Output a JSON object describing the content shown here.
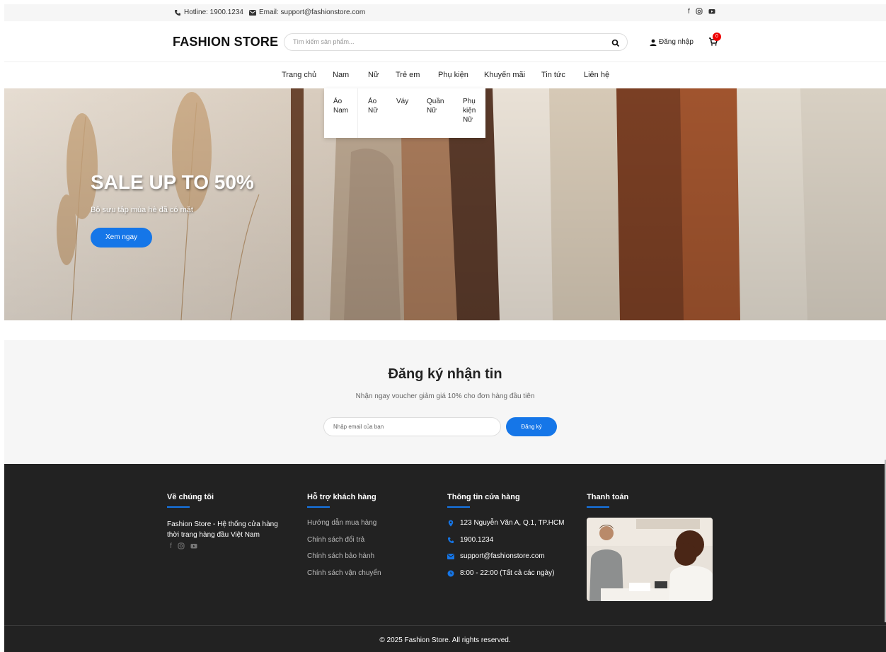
{
  "topbar": {
    "hotline": "Hotline: 1900.1234",
    "email": "Email: support@fashionstore.com",
    "social_icons": [
      "facebook-icon",
      "instagram-icon",
      "youtube-icon"
    ]
  },
  "header": {
    "logo": "FASHION STORE",
    "search_placeholder": "Tìm kiếm sản phẩm...",
    "login_label": "Đăng nhập",
    "cart_count": "0"
  },
  "nav": {
    "items": [
      {
        "label": "Trang chủ"
      },
      {
        "label": "Nam"
      },
      {
        "label": "Nữ"
      },
      {
        "label": "Trẻ em"
      },
      {
        "label": "Phụ kiện"
      },
      {
        "label": "Khuyến mãi"
      },
      {
        "label": "Tin tức"
      },
      {
        "label": "Liên hệ"
      }
    ]
  },
  "dropdown": {
    "items": [
      {
        "line1": "Áo",
        "line2": "Nam",
        "line3": ""
      },
      {
        "line1": "Áo",
        "line2": "Nữ",
        "line3": ""
      },
      {
        "line1": "Váy",
        "line2": "",
        "line3": ""
      },
      {
        "line1": "Quần",
        "line2": "Nữ",
        "line3": ""
      },
      {
        "line1": "Phụ",
        "line2": "kiện",
        "line3": "Nữ"
      }
    ]
  },
  "hero": {
    "title": "SALE UP TO 50%",
    "subtitle": "Bộ sưu tập mùa hè đã có mặt",
    "button": "Xem ngay"
  },
  "newsletter": {
    "title": "Đăng ký nhận tin",
    "subtitle": "Nhận ngay voucher giảm giá 10% cho đơn hàng đầu tiên",
    "placeholder": "Nhập email của bạn",
    "button": "Đăng ký"
  },
  "footer": {
    "about": {
      "title": "Về chúng tôi",
      "text": "Fashion Store - Hệ thống cửa hàng thời trang hàng đầu Việt Nam"
    },
    "support": {
      "title": "Hỗ trợ khách hàng",
      "links": [
        "Hướng dẫn mua hàng",
        "Chính sách đổi trả",
        "Chính sách bảo hành",
        "Chính sách vận chuyển"
      ]
    },
    "store": {
      "title": "Thông tin cửa hàng",
      "address": "123 Nguyễn Văn A, Q.1, TP.HCM",
      "phone": "1900.1234",
      "email": "support@fashionstore.com",
      "hours": "8:00 - 22:00 (Tất cả các ngày)"
    },
    "payment": {
      "title": "Thanh toán"
    },
    "copyright": "© 2025 Fashion Store. All rights reserved."
  },
  "colors": {
    "accent": "#1576e8",
    "footer_bg": "#222222",
    "badge": "#e00000"
  }
}
